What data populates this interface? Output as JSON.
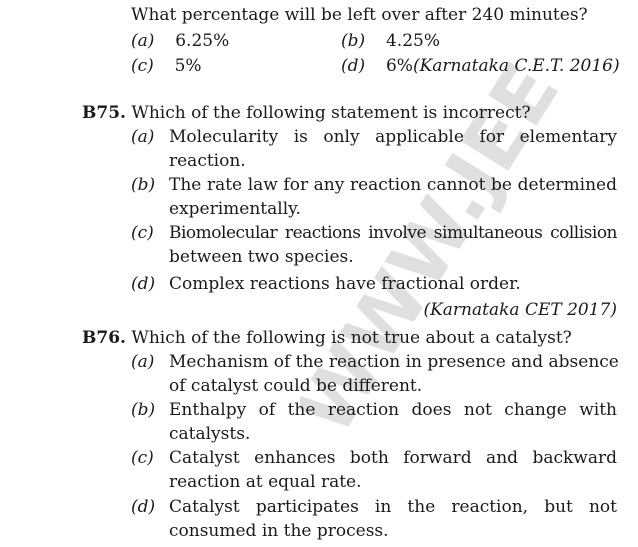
{
  "q74": {
    "stem_tail": "What percentage will be left over after 240 minutes?",
    "options": [
      {
        "label": "(a)",
        "text": "6.25%"
      },
      {
        "label": "(b)",
        "text": "4.25%"
      },
      {
        "label": "(c)",
        "text": "5%"
      },
      {
        "label": "(d)",
        "text": "6%"
      }
    ],
    "source": "(Karnataka C.E.T. 2016)"
  },
  "q75": {
    "number": "B75.",
    "stem": "Which of the following statement is incorrect?",
    "options": [
      {
        "label": "(a)",
        "line1": "Molecularity is only applicable for elementary",
        "line2": "reaction."
      },
      {
        "label": "(b)",
        "line1": "The rate law for any reaction cannot be determined",
        "line2": "experimentally."
      },
      {
        "label": "(c)",
        "line1": "Biomolecular reactions involve simultaneous collision",
        "line2": "between two species."
      },
      {
        "label": "(d)",
        "line1": "Complex reactions have fractional order.",
        "line2": ""
      }
    ],
    "source": "(Karnataka CET 2017)"
  },
  "q76": {
    "number": "B76.",
    "stem": "Which of the following is not true about a catalyst?",
    "options": [
      {
        "label": "(a)",
        "line1": "Mechanism of the reaction in presence and absence",
        "line2": "of catalyst could be different."
      },
      {
        "label": "(b)",
        "line1": "Enthalpy of the reaction does not change with",
        "line2": "catalysts."
      },
      {
        "label": "(c)",
        "line1": "Catalyst enhances both forward and backward",
        "line2": "reaction at equal rate."
      },
      {
        "label": "(d)",
        "line1": "Catalyst participates in the reaction, but not",
        "line2": "consumed in the process."
      }
    ]
  },
  "watermark": {
    "text": "WWW.JEE",
    "color": "#c8c8c8"
  }
}
